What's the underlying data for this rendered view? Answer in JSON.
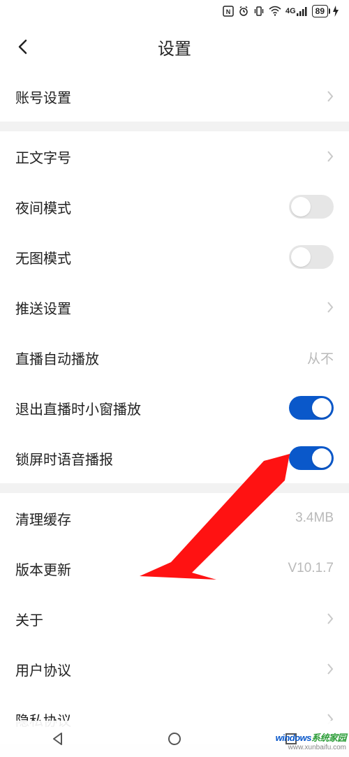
{
  "status": {
    "battery": "89",
    "network": "4G"
  },
  "header": {
    "title": "设置"
  },
  "rows": {
    "account": "账号设置",
    "font_size": "正文字号",
    "night_mode": "夜间模式",
    "no_image": "无图模式",
    "push": "推送设置",
    "live_autoplay_label": "直播自动播放",
    "live_autoplay_value": "从不",
    "exit_pip": "退出直播时小窗播放",
    "lock_voice": "锁屏时语音播报",
    "clear_cache_label": "清理缓存",
    "clear_cache_value": "3.4MB",
    "version_label": "版本更新",
    "version_value": "V10.1.7",
    "about": "关于",
    "user_agreement": "用户协议",
    "privacy": "隐私协议"
  },
  "watermark": {
    "brand_a": "windows",
    "brand_b": "系统家园",
    "url": "www.xunbaifu.com"
  }
}
